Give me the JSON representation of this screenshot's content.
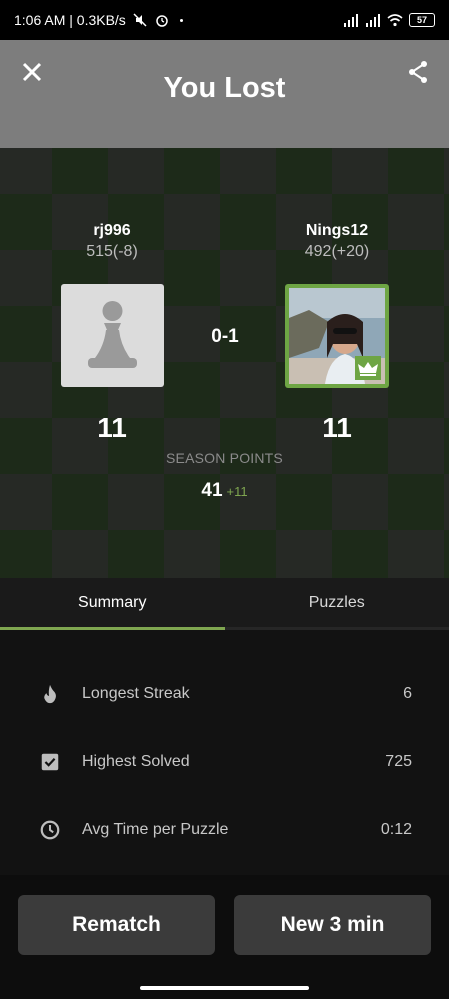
{
  "status_bar": {
    "time_speed": "1:06 AM | 0.3KB/s",
    "battery": "57"
  },
  "header": {
    "title": "You Lost"
  },
  "players": {
    "left": {
      "name": "rj996",
      "rating": "515(-8)",
      "points": "11"
    },
    "right": {
      "name": "Nings12",
      "rating": "492(+20)",
      "points": "11"
    }
  },
  "result": {
    "score": "0-1"
  },
  "season": {
    "label": "SEASON POINTS",
    "value": "41",
    "delta": "+11"
  },
  "tabs": [
    {
      "label": "Summary",
      "active": true
    },
    {
      "label": "Puzzles",
      "active": false
    }
  ],
  "summary": {
    "rows": [
      {
        "icon": "flame-icon",
        "label": "Longest Streak",
        "value": "6"
      },
      {
        "icon": "checkbox-icon",
        "label": "Highest Solved",
        "value": "725"
      },
      {
        "icon": "clock-icon",
        "label": "Avg Time per Puzzle",
        "value": "0:12"
      }
    ]
  },
  "buttons": {
    "rematch": "Rematch",
    "new_game": "New 3 min"
  },
  "colors": {
    "accent_green": "#7fa650",
    "header_bg": "#7d7d7d",
    "button_bg": "#3b3b3b"
  }
}
